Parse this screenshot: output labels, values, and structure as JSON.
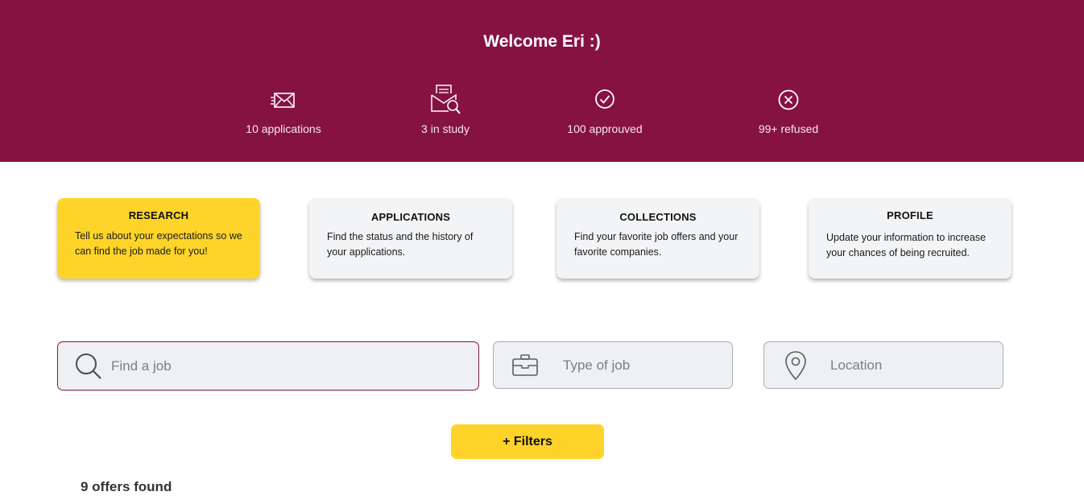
{
  "header": {
    "welcome": "Welcome Eri :)",
    "stats": [
      {
        "icon": "envelope-icon",
        "label": "10 applications"
      },
      {
        "icon": "mail-search-icon",
        "label": "3 in study"
      },
      {
        "icon": "check-circle-icon",
        "label": "100 approuved"
      },
      {
        "icon": "x-circle-icon",
        "label": "99+ refused"
      }
    ]
  },
  "cards": [
    {
      "title": "RESEARCH",
      "desc": "Tell us about your expectations so we can find the job made for you!",
      "active": true
    },
    {
      "title": "APPLICATIONS",
      "desc": "Find the status and the history of your applications."
    },
    {
      "title": "COLLECTIONS",
      "desc": "Find your favorite job offers and your favorite companies."
    },
    {
      "title": "PROFILE",
      "desc": "Update your information to increase your chances of being recruited."
    }
  ],
  "search": {
    "find_placeholder": "Find a job",
    "type_placeholder": "Type of job",
    "location_placeholder": "Location"
  },
  "filters_label": "+ Filters",
  "results": "9 offers found",
  "colors": {
    "brand": "#861242",
    "accent": "#fed42a",
    "card": "#f3f4f6"
  }
}
